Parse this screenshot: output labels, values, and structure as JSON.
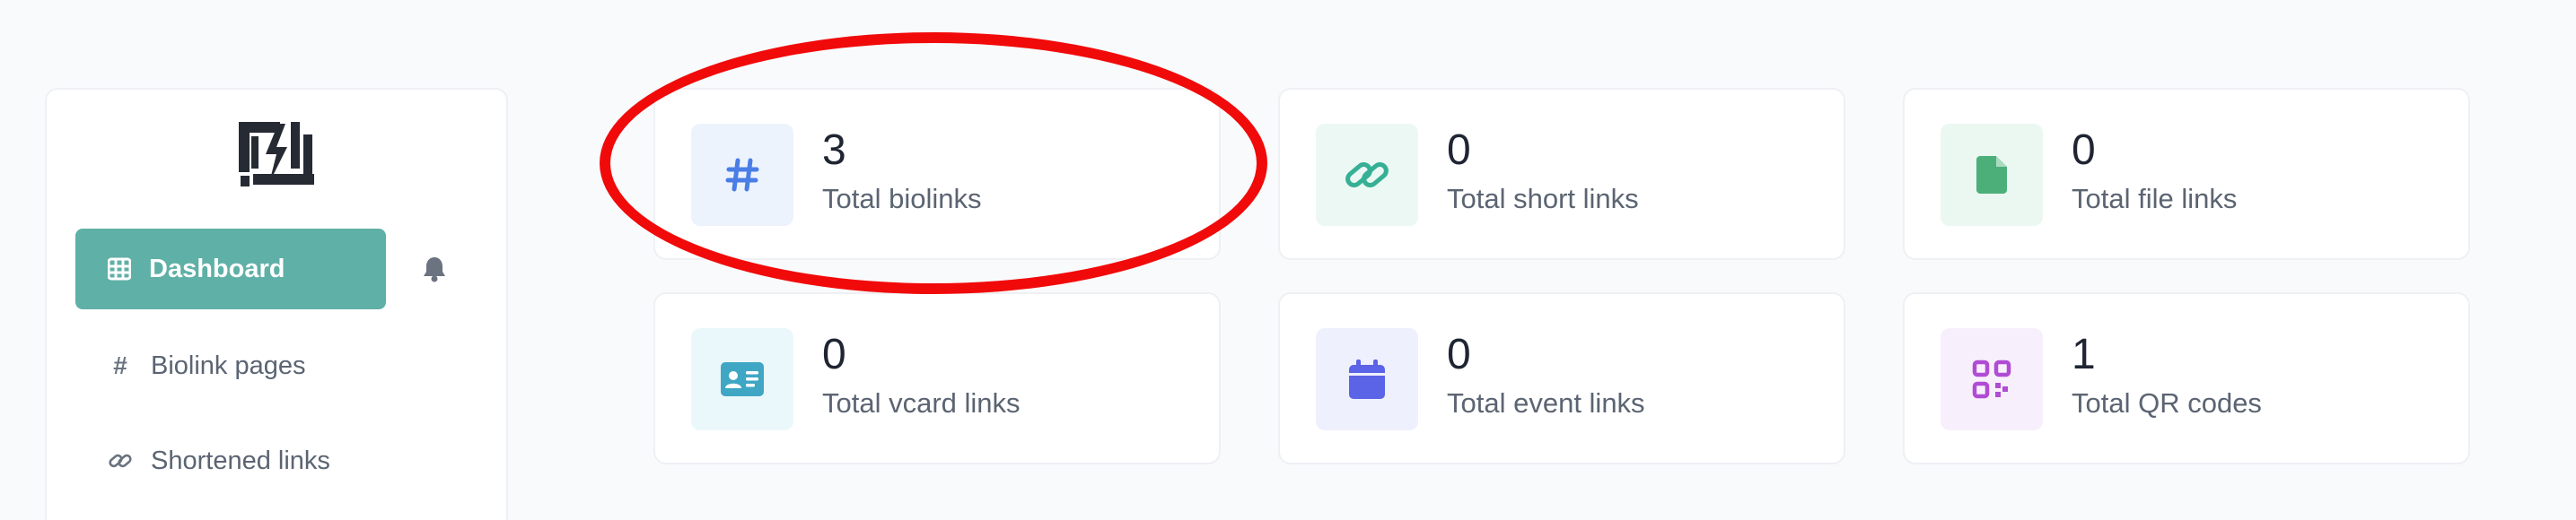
{
  "sidebar": {
    "logo_icon": "brand-logo",
    "active_item": {
      "label": "Dashboard",
      "icon": "table-grid-icon"
    },
    "notifications_icon": "bell-icon",
    "items": [
      {
        "label": "Biolink pages",
        "icon": "hash-icon"
      },
      {
        "label": "Shortened links",
        "icon": "link-icon"
      }
    ]
  },
  "stats": [
    {
      "value": "3",
      "label": "Total biolinks",
      "icon": "hash-icon",
      "color": "#4a7ee6",
      "bg": "#edf3fd"
    },
    {
      "value": "0",
      "label": "Total short links",
      "icon": "link-icon",
      "color": "#36b095",
      "bg": "#ecf8f4"
    },
    {
      "value": "0",
      "label": "Total file links",
      "icon": "file-icon",
      "color": "#4caf7a",
      "bg": "#ebf8f1"
    },
    {
      "value": "0",
      "label": "Total vcard links",
      "icon": "id-card-icon",
      "color": "#3fa6c4",
      "bg": "#ebf8fb"
    },
    {
      "value": "0",
      "label": "Total event links",
      "icon": "calendar-icon",
      "color": "#5b63e6",
      "bg": "#eef0fd"
    },
    {
      "value": "1",
      "label": "Total QR codes",
      "icon": "qr-code-icon",
      "color": "#b04cd4",
      "bg": "#f8effc"
    }
  ],
  "colors": {
    "accent": "#5fb0a6",
    "annotation": "#f10a0a"
  }
}
